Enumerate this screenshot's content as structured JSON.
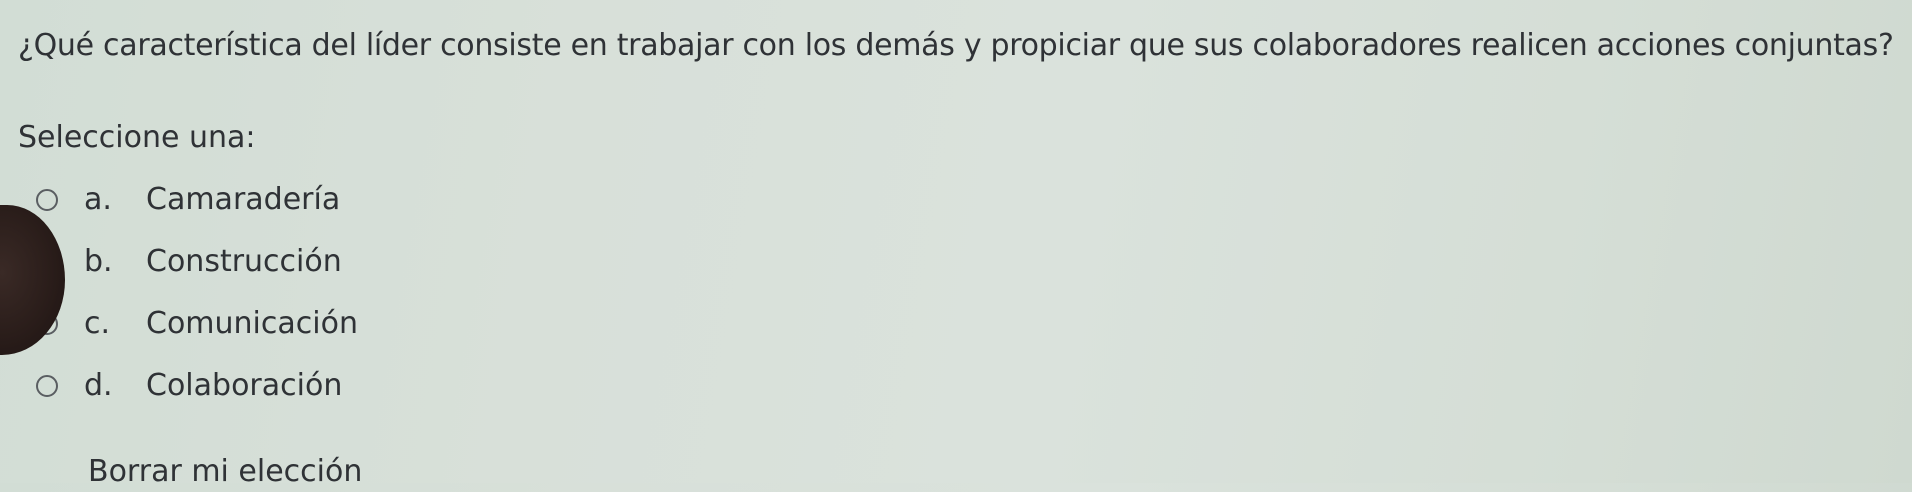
{
  "question": {
    "text": "¿Qué característica del líder consiste en trabajar con los demás y propiciar que sus colaboradores realicen acciones conjuntas?"
  },
  "prompt": "Seleccione una:",
  "options": [
    {
      "letter": "a.",
      "label": "Camaradería"
    },
    {
      "letter": "b.",
      "label": "Construcción"
    },
    {
      "letter": "c.",
      "label": "Comunicación"
    },
    {
      "letter": "d.",
      "label": "Colaboración"
    }
  ],
  "clear_choice": "Borrar mi elección",
  "colors": {
    "background": "#d8e0d9",
    "text": "#2f3236",
    "radio_border": "#5a5e62"
  }
}
